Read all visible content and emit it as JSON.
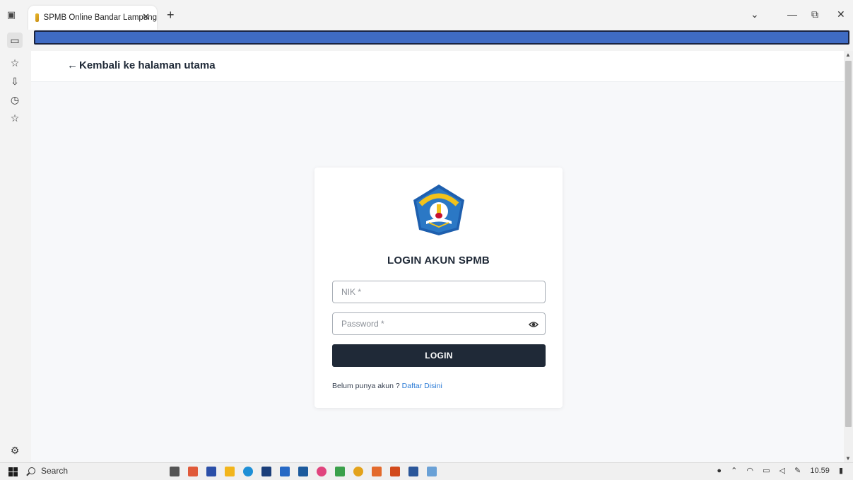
{
  "browser": {
    "tab_title": "SPMB Online Bandar Lampung",
    "tab_close": "✕",
    "new_tab": "+",
    "tab_list": "⌄",
    "minimize": "—",
    "restore": "⧉",
    "close": "✕"
  },
  "page": {
    "back_link": "Kembali ke halaman utama",
    "back_arrow": "←"
  },
  "login": {
    "title": "LOGIN AKUN SPMB",
    "nik_placeholder": "NIK *",
    "nik_value": "",
    "password_placeholder": "Password *",
    "password_value": "",
    "button_label": "LOGIN",
    "register_prompt": "Belum punya akun ? ",
    "register_link": "Daftar Disini"
  },
  "taskbar": {
    "search_label": "Search",
    "clock": "10.59"
  },
  "colors": {
    "accent_dark": "#1f2937",
    "link_blue": "#2b7bd6",
    "page_background": "#f7f8fa",
    "logo_blue": "#2b78c5",
    "logo_gold": "#f2c21b"
  },
  "icons": [
    "collections-icon",
    "sidebar-toggle-icon",
    "favorites-icon",
    "history-icon",
    "star-icon",
    "settings-icon",
    "eye-icon",
    "windows-start-icon",
    "search-icon"
  ]
}
